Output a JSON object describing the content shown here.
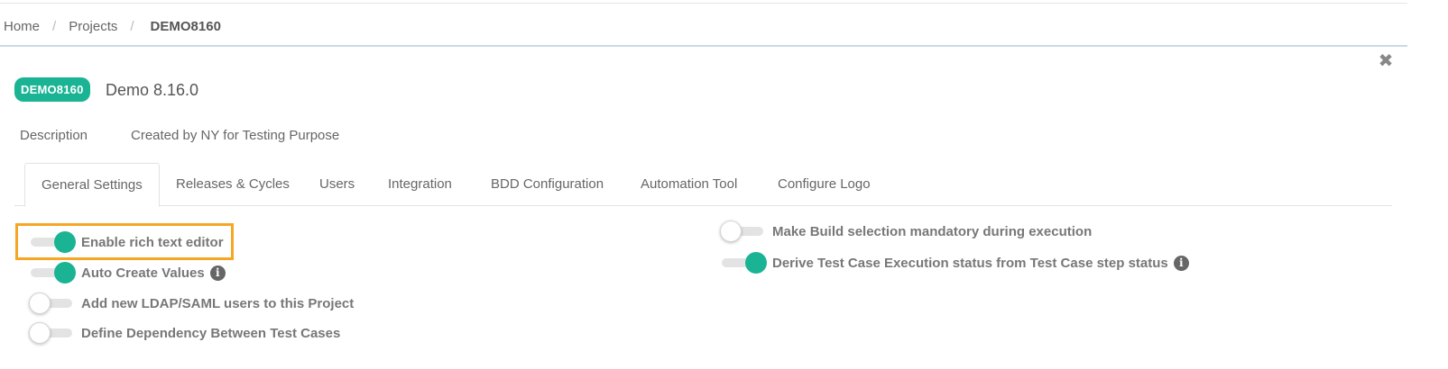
{
  "breadcrumb": {
    "items": [
      "Home",
      "Projects"
    ],
    "separator": "/",
    "current": "DEMO8160"
  },
  "project": {
    "key": "DEMO8160",
    "name": "Demo 8.16.0",
    "description_label": "Description",
    "description": "Created by NY for Testing Purpose"
  },
  "close": {
    "icon": "close-icon",
    "glyph": "✖"
  },
  "tabs": [
    {
      "label": "General Settings",
      "active": true
    },
    {
      "label": "Releases & Cycles",
      "active": false
    },
    {
      "label": "Users",
      "active": false
    },
    {
      "label": "Integration",
      "active": false
    },
    {
      "label": "BDD Configuration",
      "active": false
    },
    {
      "label": "Automation Tool",
      "active": false
    },
    {
      "label": "Configure Logo",
      "active": false
    }
  ],
  "settings": {
    "left": [
      {
        "label": "Enable rich text editor",
        "enabled": true,
        "info": false,
        "highlighted": true
      },
      {
        "label": "Auto Create Values",
        "enabled": true,
        "info": true
      },
      {
        "label": "Add new LDAP/SAML users to this Project",
        "enabled": false,
        "info": false
      },
      {
        "label": "Define Dependency Between Test Cases",
        "enabled": false,
        "info": false
      }
    ],
    "right": [
      {
        "label": "Make Build selection mandatory during execution",
        "enabled": false,
        "info": false
      },
      {
        "label": "Derive Test Case Execution status from Test Case step status",
        "enabled": true,
        "info": true
      }
    ]
  },
  "colors": {
    "accent": "#1ab394",
    "highlight": "#f5a623"
  },
  "info_glyph": "i"
}
